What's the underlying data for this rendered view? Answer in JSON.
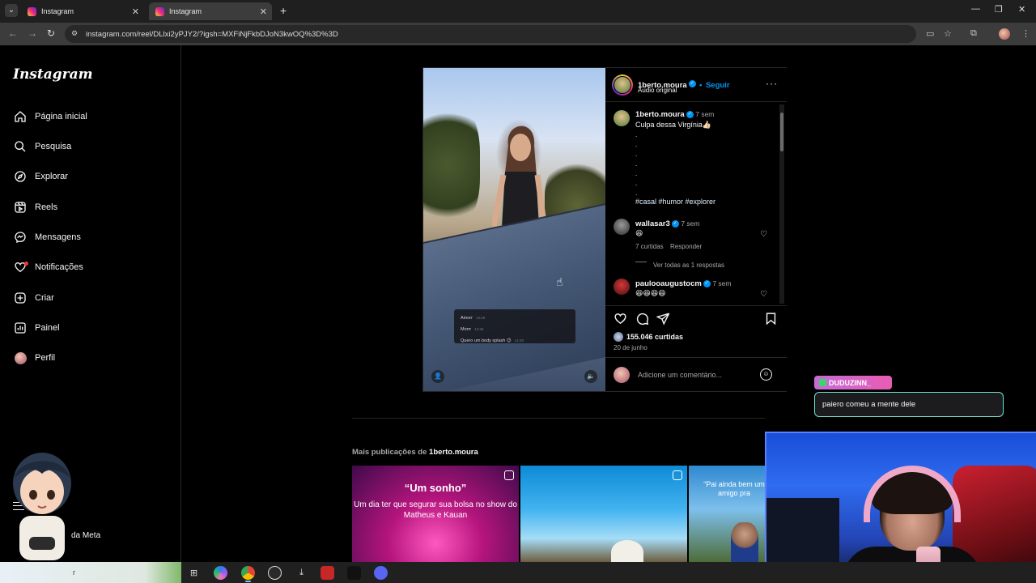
{
  "browser": {
    "tabs": [
      {
        "title": "Instagram"
      },
      {
        "title": "Instagram"
      }
    ],
    "url": "instagram.com/reel/DLlxi2yPJY2/?igsh=MXFiNjFkbDJoN3kwOQ%3D%3D"
  },
  "sidebar": {
    "logo": "Instagram",
    "items": [
      {
        "label": "Página inicial",
        "icon": "home-icon"
      },
      {
        "label": "Pesquisa",
        "icon": "search-icon"
      },
      {
        "label": "Explorar",
        "icon": "compass-icon"
      },
      {
        "label": "Reels",
        "icon": "reels-icon"
      },
      {
        "label": "Mensagens",
        "icon": "messenger-icon"
      },
      {
        "label": "Notificações",
        "icon": "heart-icon"
      },
      {
        "label": "Criar",
        "icon": "plus-square-icon"
      },
      {
        "label": "Painel",
        "icon": "chart-icon"
      },
      {
        "label": "Perfil",
        "icon": "avatar"
      }
    ],
    "more_text": "da Meta"
  },
  "reel": {
    "video_overlay": [
      {
        "text": "Amorr",
        "time": "14:28"
      },
      {
        "text": "Morrr",
        "time": "14:28"
      },
      {
        "text": "Quero um body splash 😉",
        "time": "14:29"
      }
    ]
  },
  "post": {
    "author": "1berto.moura",
    "follow_separator": "•",
    "follow_label": "Seguir",
    "audio": "Áudio original",
    "caption": {
      "author": "1berto.moura",
      "age": "7 sem",
      "text": "Culpa dessa Virgínia👍🏻",
      "dots": [
        ".",
        ".",
        ".",
        ".",
        ".",
        ".",
        "."
      ],
      "hashtags": "#casal #humor #explorer"
    },
    "comments": [
      {
        "user": "wallasar3",
        "age": "7 sem",
        "text": "😆",
        "likes": "7 curtidas",
        "reply": "Responder",
        "view_replies": "Ver todas as 1 respostas"
      },
      {
        "user": "paulooaugustocm",
        "age": "7 sem",
        "text": "😆😆😆😆"
      }
    ],
    "likes": "155.046 curtidas",
    "date": "20 de junho",
    "comment_placeholder": "Adicione um comentário..."
  },
  "more_posts": {
    "label_prefix": "Mais publicações de",
    "label_user": "1berto.moura",
    "thumbs": [
      {
        "title": "“Um sonho”",
        "caption": "Um dia ter que segurar sua bolsa no show do Matheus e Kauan"
      },
      {
        "title": "",
        "caption": ""
      },
      {
        "title": "",
        "caption": "“Pai ainda bem um amigo pra"
      }
    ]
  },
  "stream": {
    "chat_user": "DUDUZINN_",
    "chat_message": "paiero comeu a mente dele"
  },
  "taskbar": {
    "search_placeholder": "r"
  },
  "colors": {
    "accent": "#0095f6",
    "background": "#000000",
    "border": "#262626"
  }
}
